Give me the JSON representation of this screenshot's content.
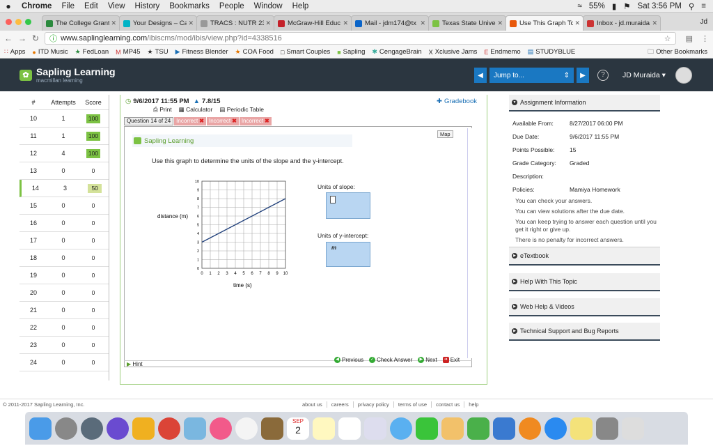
{
  "menubar": {
    "apple": "",
    "app": "Chrome",
    "items": [
      "File",
      "Edit",
      "View",
      "History",
      "Bookmarks",
      "People",
      "Window",
      "Help"
    ],
    "battery": "55%",
    "clock": "Sat 3:56 PM"
  },
  "tabs": [
    {
      "label": "The College Grant",
      "color": "#2b8a3e"
    },
    {
      "label": "Your Designs – Ca",
      "color": "#00b3c6"
    },
    {
      "label": "TRACS : NUTR 23",
      "color": "#999999"
    },
    {
      "label": "McGraw-Hill Educ",
      "color": "#c4212a"
    },
    {
      "label": "Mail - jdm174@tx",
      "color": "#0a64c8"
    },
    {
      "label": "Texas State Univer",
      "color": "#7cc243"
    },
    {
      "label": "Use This Graph To",
      "color": "#e8590c"
    },
    {
      "label": "Inbox - jd.muraida",
      "color": "#cc3333"
    }
  ],
  "profile": "Jd",
  "address": {
    "prefix": "www.saplinglearning.com",
    "path": "/ibiscms/mod/ibis/view.php?id=4338516"
  },
  "bookmarks": [
    "Apps",
    "ITD Music",
    "FedLoan",
    "MP45",
    "TSU",
    "Fitness Blender",
    "COA Food",
    "Smart Couples",
    "Sapling",
    "CengageBrain",
    "Xclusive Jams",
    "Endmemo",
    "STUDYBLUE"
  ],
  "other_bookmarks": "Other Bookmarks",
  "sapling": {
    "brand": "Sapling Learning",
    "sub": "macmillan learning",
    "jump": "Jump to...",
    "user": "JD Muraida"
  },
  "score_header": {
    "num": "#",
    "attempts": "Attempts",
    "score": "Score"
  },
  "scores": [
    {
      "n": "10",
      "a": "1",
      "s": "100"
    },
    {
      "n": "11",
      "a": "1",
      "s": "100"
    },
    {
      "n": "12",
      "a": "4",
      "s": "100"
    },
    {
      "n": "13",
      "a": "0",
      "s": "0"
    },
    {
      "n": "14",
      "a": "3",
      "s": "50"
    },
    {
      "n": "15",
      "a": "0",
      "s": "0"
    },
    {
      "n": "16",
      "a": "0",
      "s": "0"
    },
    {
      "n": "17",
      "a": "0",
      "s": "0"
    },
    {
      "n": "18",
      "a": "0",
      "s": "0"
    },
    {
      "n": "19",
      "a": "0",
      "s": "0"
    },
    {
      "n": "20",
      "a": "0",
      "s": "0"
    },
    {
      "n": "21",
      "a": "0",
      "s": "0"
    },
    {
      "n": "22",
      "a": "0",
      "s": "0"
    },
    {
      "n": "23",
      "a": "0",
      "s": "0"
    },
    {
      "n": "24",
      "a": "0",
      "s": "0"
    }
  ],
  "qhead": {
    "date": "9/6/2017 11:55 PM",
    "score": "7.8/15",
    "gradebook": "Gradebook"
  },
  "tools": {
    "print": "Print",
    "calc": "Calculator",
    "periodic": "Periodic Table"
  },
  "qtabs": {
    "current": "Question 14 of 24",
    "attempts": [
      "Incorrect",
      "Incorrect",
      "Incorrect"
    ]
  },
  "question": {
    "logo": "Sapling Learning",
    "logo_sub": "macmillan learning",
    "map": "Map",
    "prompt": "Use this graph to determine the units of the slope and the y-intercept.",
    "slope_label": "Units of slope:",
    "yint_label": "Units of y-intercept:",
    "yint_value": "m"
  },
  "chart_data": {
    "type": "line",
    "x": [
      0,
      10
    ],
    "y": [
      3,
      8
    ],
    "xlabel": "time (s)",
    "ylabel": "distance (m)",
    "xlim": [
      0,
      10
    ],
    "ylim": [
      0,
      10
    ],
    "xticks": [
      "0",
      "1",
      "2",
      "3",
      "4",
      "5",
      "6",
      "7",
      "8",
      "9",
      "10"
    ],
    "yticks": [
      "0",
      "1",
      "2",
      "3",
      "4",
      "5",
      "6",
      "7",
      "8",
      "9",
      "10"
    ],
    "grid": true
  },
  "qfoot": {
    "previous": "Previous",
    "check": "Check Answer",
    "next": "Next",
    "exit": "Exit",
    "hint": "Hint"
  },
  "assignment": {
    "title": "Assignment Information",
    "rows": [
      {
        "k": "Available From:",
        "v": "8/27/2017 06:00 PM"
      },
      {
        "k": "Due Date:",
        "v": "9/6/2017 11:55 PM"
      },
      {
        "k": "Points Possible:",
        "v": "15"
      },
      {
        "k": "Grade Category:",
        "v": "Graded"
      },
      {
        "k": "Description:",
        "v": ""
      },
      {
        "k": "Policies:",
        "v": "Mamiya Homework"
      }
    ],
    "policies": [
      "You can check your answers.",
      "You can view solutions after the due date.",
      "You can keep trying to answer each question until you get it right or give up.",
      "There is no penalty for incorrect answers."
    ]
  },
  "sections": [
    "eTextbook",
    "Help With This Topic",
    "Web Help & Videos",
    "Technical Support and Bug Reports"
  ],
  "footer": {
    "copy": "© 2011-2017 Sapling Learning, Inc.",
    "links": [
      "about us",
      "careers",
      "privacy policy",
      "terms of use",
      "contact us",
      "help"
    ]
  },
  "dock": {
    "calendar_month": "SEP",
    "calendar_day": "2"
  }
}
